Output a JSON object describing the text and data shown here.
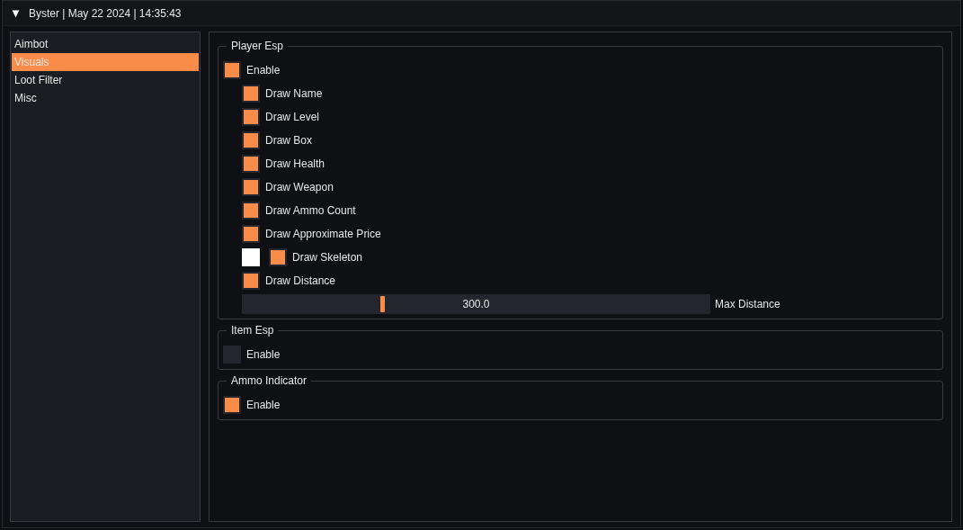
{
  "window": {
    "title": "Byster | May 22 2024 | 14:35:43",
    "collapse_icon": "▼"
  },
  "sidebar": {
    "items": [
      {
        "label": "Aimbot",
        "selected": false
      },
      {
        "label": "Visuals",
        "selected": true
      },
      {
        "label": "Loot Filter",
        "selected": false
      },
      {
        "label": "Misc",
        "selected": false
      }
    ]
  },
  "groups": [
    {
      "title": "Player Esp",
      "enable": {
        "label": "Enable",
        "checked": true
      },
      "options": [
        {
          "kind": "checkbox",
          "label": "Draw Name",
          "checked": true
        },
        {
          "kind": "checkbox",
          "label": "Draw Level",
          "checked": true
        },
        {
          "kind": "checkbox",
          "label": "Draw Box",
          "checked": true
        },
        {
          "kind": "checkbox",
          "label": "Draw Health",
          "checked": true
        },
        {
          "kind": "checkbox",
          "label": "Draw Weapon",
          "checked": true
        },
        {
          "kind": "checkbox",
          "label": "Draw Ammo Count",
          "checked": true
        },
        {
          "kind": "checkbox",
          "label": "Draw Approximate Price",
          "checked": true
        },
        {
          "kind": "color-checkbox",
          "label": "Draw Skeleton",
          "checked": true,
          "color": "#ffffff"
        },
        {
          "kind": "checkbox",
          "label": "Draw Distance",
          "checked": true
        },
        {
          "kind": "slider",
          "label": "Max Distance",
          "value": "300.0",
          "level": 0.3
        }
      ]
    },
    {
      "title": "Item Esp",
      "enable": {
        "label": "Enable",
        "checked": false
      }
    },
    {
      "title": "Ammo Indicator",
      "enable": {
        "label": "Enable",
        "checked": true
      }
    }
  ]
}
